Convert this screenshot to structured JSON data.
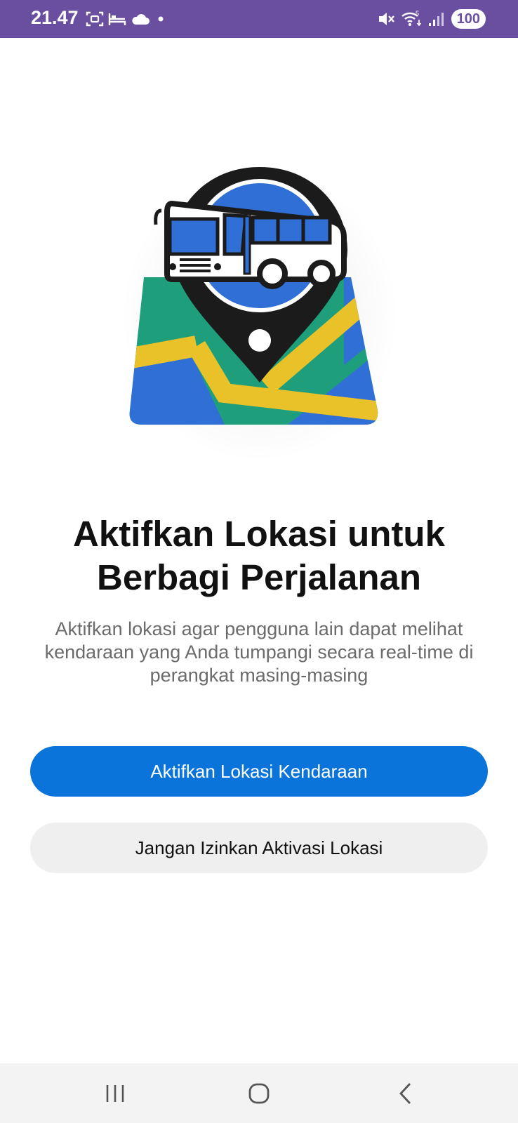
{
  "status_bar": {
    "time": "21.47",
    "battery": "100",
    "left_icons": [
      "screenshot-icon",
      "sleep-icon",
      "cloud-icon",
      "dot-icon"
    ],
    "right_icons": [
      "mute-icon",
      "wifi-icon",
      "signal-icon"
    ],
    "background_color": "#6a4fa0"
  },
  "hero": {
    "icon": "bus-map-pin-icon",
    "colors": {
      "blue": "#2f6fd6",
      "green": "#1e9e7a",
      "yellow": "#e9c22a",
      "dark": "#1b1b1b"
    }
  },
  "main": {
    "title": "Aktifkan Lokasi untuk Berbagi Perjalanan",
    "subtitle": "Aktifkan lokasi agar pengguna lain dapat melihat kendaraan yang Anda tumpangi secara real-time di perangkat masing-masing"
  },
  "actions": {
    "enable_label": "Aktifkan Lokasi Kendaraan",
    "deny_label": "Jangan Izinkan Aktivasi Lokasi",
    "primary_color": "#0a74da",
    "secondary_color": "#efefef"
  },
  "nav": {
    "icons": [
      "recent-apps-icon",
      "home-icon",
      "back-icon"
    ]
  }
}
